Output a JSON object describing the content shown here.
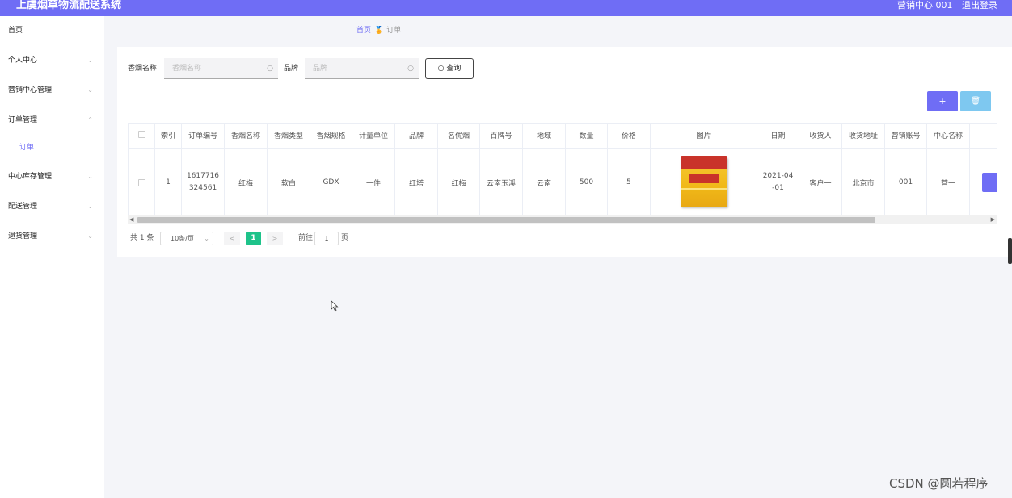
{
  "header": {
    "title": "上虞烟草物流配送系统",
    "user": "营销中心 001",
    "logout": "退出登录"
  },
  "sidebar": {
    "items": [
      {
        "label": "首页"
      },
      {
        "label": "个人中心"
      },
      {
        "label": "营销中心管理"
      },
      {
        "label": "订单管理"
      },
      {
        "label": "中心库存管理"
      },
      {
        "label": "配送管理"
      },
      {
        "label": "退货管理"
      }
    ],
    "sub_active": "订单"
  },
  "breadcrumb": {
    "home": "首页",
    "current": "订单"
  },
  "search": {
    "field1_label": "香烟名称",
    "field1_placeholder": "香烟名称",
    "field2_label": "品牌",
    "field2_placeholder": "品牌",
    "query_button": "查询"
  },
  "actions": {
    "add": "+",
    "delete": "🗑"
  },
  "table": {
    "headers": [
      "索引",
      "订单编号",
      "香烟名称",
      "香烟类型",
      "香烟规格",
      "计量单位",
      "品牌",
      "名优烟",
      "百牌号",
      "地域",
      "数量",
      "价格",
      "图片",
      "日期",
      "收货人",
      "收货地址",
      "营销账号",
      "中心名称"
    ],
    "row": {
      "index": "1",
      "order_no_1": "1617716",
      "order_no_2": "324561",
      "name": "红梅",
      "type": "软白",
      "spec": "GDX",
      "unit": "一件",
      "brand": "红塔",
      "famous": "红梅",
      "code": "云南玉溪",
      "region": "云南",
      "qty": "500",
      "price": "5",
      "date_1": "2021-04",
      "date_2": "-01",
      "receiver": "客户一",
      "address": "北京市",
      "account": "001",
      "center": "营一"
    }
  },
  "pagination": {
    "total": "共 1 条",
    "page_size": "10条/页",
    "current": "1",
    "goto": "前往",
    "goto_value": "1",
    "page_unit": "页"
  },
  "watermark": "CSDN @圆若程序",
  "colors": {
    "primary": "#6f6df5",
    "success": "#1ec38a",
    "info": "#7ec8f0"
  }
}
